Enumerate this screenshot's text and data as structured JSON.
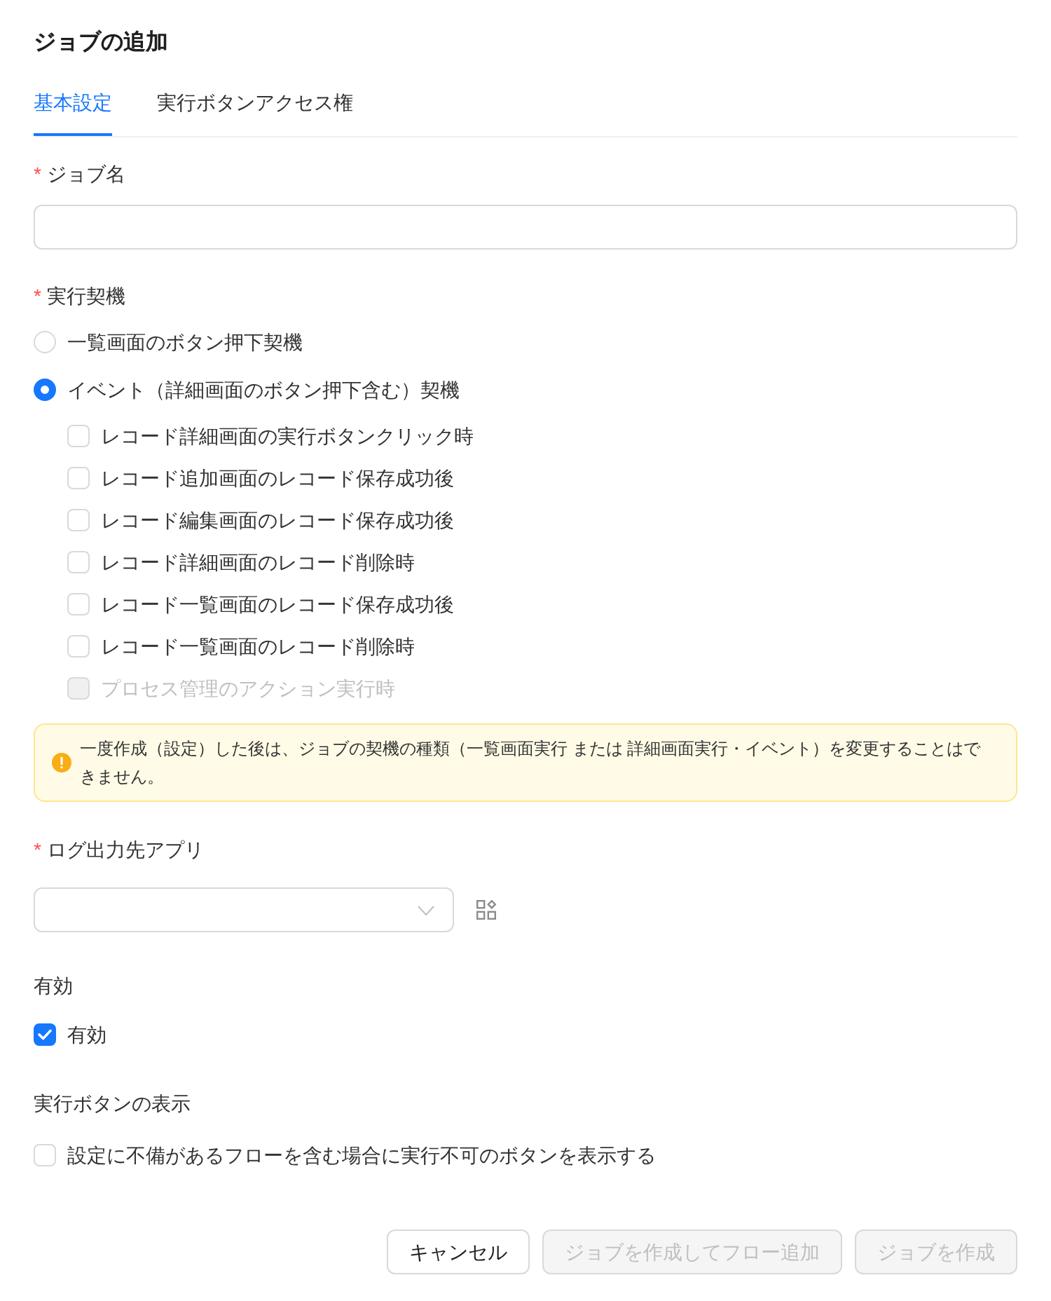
{
  "title": "ジョブの追加",
  "tabs": [
    {
      "label": "基本設定",
      "selected": true
    },
    {
      "label": "実行ボタンアクセス権",
      "selected": false
    }
  ],
  "job_name": {
    "required_mark": "*",
    "label": "ジョブ名"
  },
  "trigger": {
    "required_mark": "*",
    "label": "実行契機",
    "options": [
      {
        "label": "一覧画面のボタン押下契機",
        "selected": false
      },
      {
        "label": "イベント（詳細画面のボタン押下含む）契機",
        "selected": true
      }
    ],
    "events": [
      {
        "label": "レコード詳細画面の実行ボタンクリック時",
        "checked": false,
        "disabled": false
      },
      {
        "label": "レコード追加画面のレコード保存成功後",
        "checked": false,
        "disabled": false
      },
      {
        "label": "レコード編集画面のレコード保存成功後",
        "checked": false,
        "disabled": false
      },
      {
        "label": "レコード詳細画面のレコード削除時",
        "checked": false,
        "disabled": false
      },
      {
        "label": "レコード一覧画面のレコード保存成功後",
        "checked": false,
        "disabled": false
      },
      {
        "label": "レコード一覧画面のレコード削除時",
        "checked": false,
        "disabled": false
      },
      {
        "label": "プロセス管理のアクション実行時",
        "checked": false,
        "disabled": true
      }
    ],
    "alert": "一度作成（設定）した後は、ジョブの契機の種類（一覧画面実行 または 詳細画面実行・イベント）を変更することはできません。"
  },
  "log_app": {
    "required_mark": "*",
    "label": "ログ出力先アプリ"
  },
  "enabled": {
    "label": "有効",
    "option": {
      "label": "有効",
      "checked": true
    }
  },
  "button_display": {
    "label": "実行ボタンの表示",
    "option": {
      "label": "設定に不備があるフローを含む場合に実行不可のボタンを表示する",
      "checked": false
    }
  },
  "buttons": [
    {
      "label": "キャンセル",
      "disabled": false
    },
    {
      "label": "ジョブを作成してフロー追加",
      "disabled": true
    },
    {
      "label": "ジョブを作成",
      "disabled": true
    }
  ]
}
